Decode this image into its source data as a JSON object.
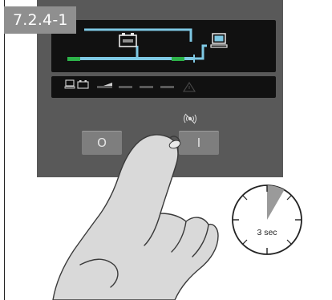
{
  "figure_label": "7.2.4-1",
  "buttons": {
    "off_symbol": "O",
    "on_symbol": "I"
  },
  "timer": {
    "duration_label": "3 sec"
  },
  "icons": [
    "battery-icon",
    "computer-icon",
    "mute-alarm-icon",
    "warning-icon",
    "stopwatch-icon",
    "hand-pointing-icon"
  ],
  "colors": {
    "panel": "#595959",
    "display": "#111111",
    "power_path": "#7ec8e3",
    "status_ok": "#2db34a",
    "label_tab": "#8f8f8f"
  }
}
